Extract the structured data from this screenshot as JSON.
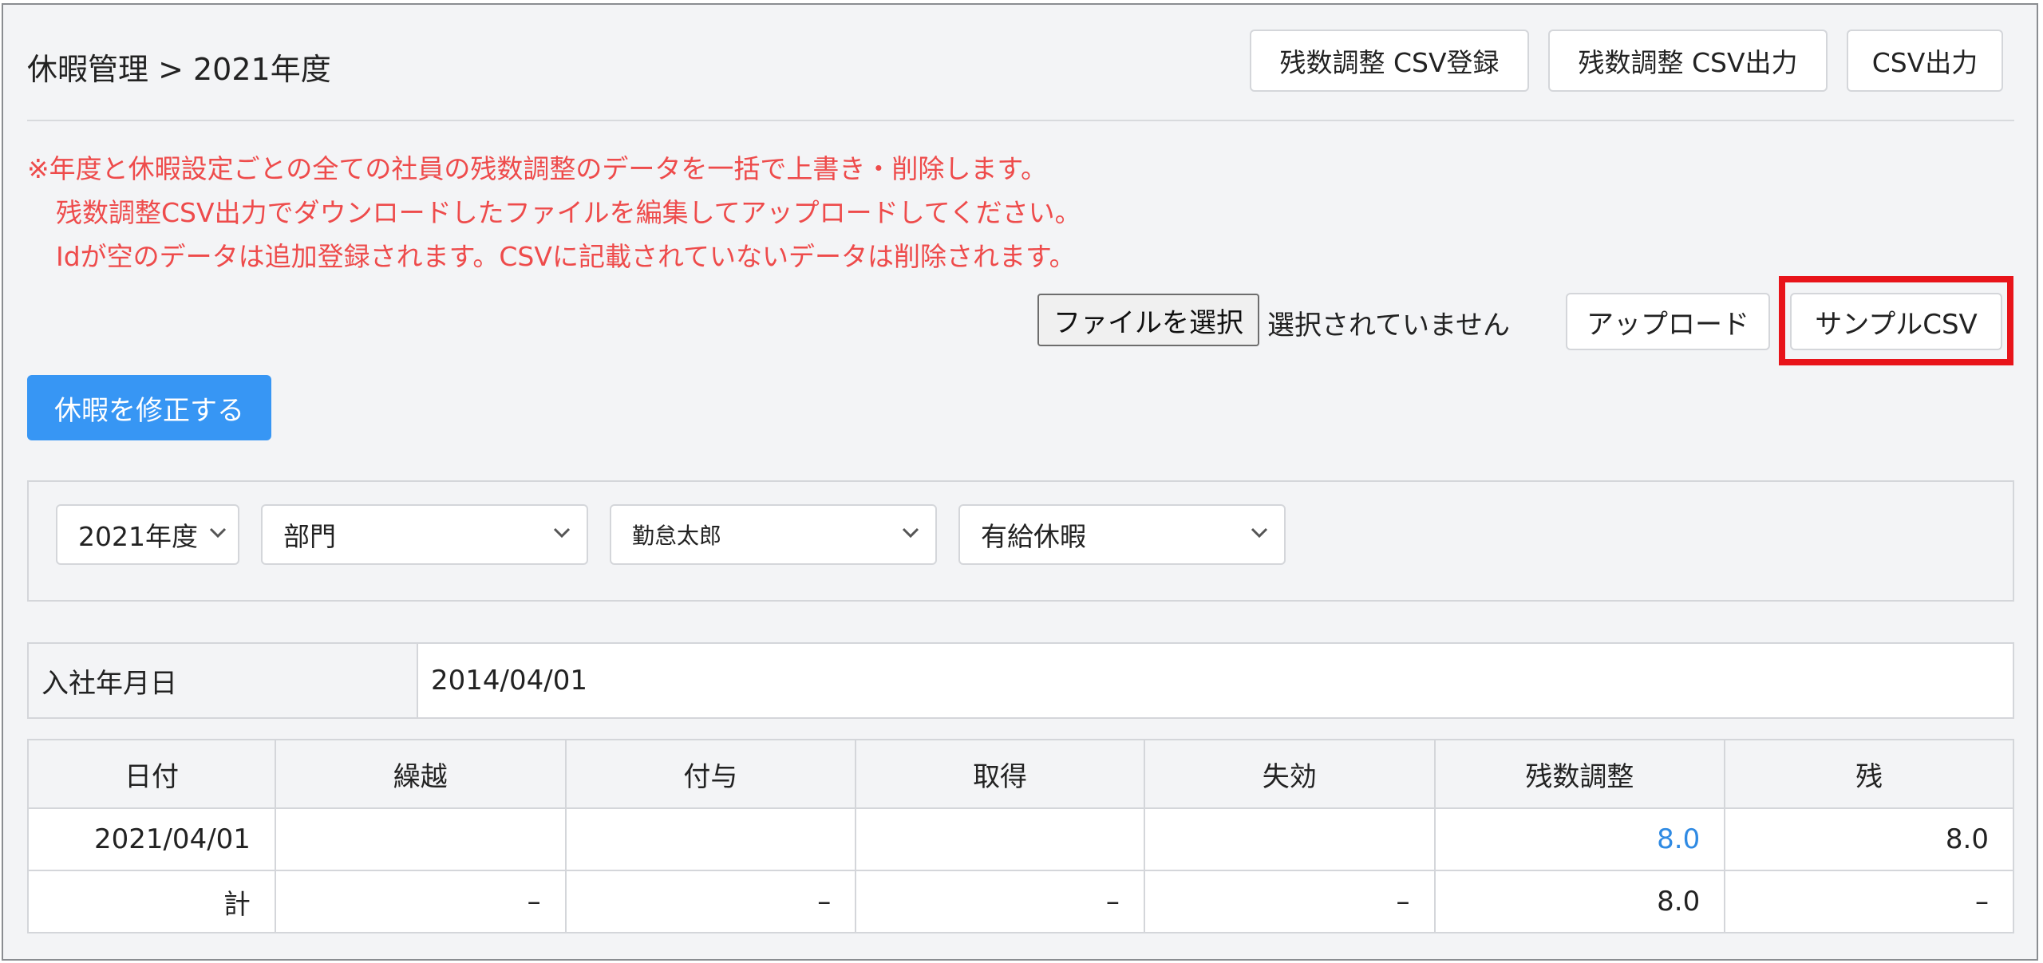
{
  "header": {
    "title": "休暇管理 > 2021年度",
    "btn_csv_register": "残数調整 CSV登録",
    "btn_csv_export_adjust": "残数調整 CSV出力",
    "btn_csv_export": "CSV出力"
  },
  "notes": [
    "※年度と休暇設定ごとの全ての社員の残数調整のデータを一括で上書き・削除します。",
    "残数調整CSV出力でダウンロードしたファイルを編集してアップロードしてください。",
    "Idが空のデータは追加登録されます。CSVに記載されていないデータは削除されます。"
  ],
  "upload": {
    "file_button": "ファイルを選択",
    "file_status": "選択されていません",
    "upload_button": "アップロード",
    "sample_button": "サンプルCSV"
  },
  "actions": {
    "edit_button": "休暇を修正する"
  },
  "filters": {
    "year": "2021年度",
    "department": "部門",
    "employee": "勤怠太郎",
    "leave_type": "有給休暇"
  },
  "info": {
    "label": "入社年月日",
    "value": "2014/04/01"
  },
  "table": {
    "headers": [
      "日付",
      "繰越",
      "付与",
      "取得",
      "失効",
      "残数調整",
      "残"
    ],
    "rows": [
      [
        "2021/04/01",
        "",
        "",
        "",
        "",
        "8.0",
        "8.0"
      ],
      [
        "計",
        "–",
        "–",
        "–",
        "–",
        "8.0",
        "–"
      ]
    ]
  },
  "colors": {
    "note_text": "#ee4b4b",
    "primary": "#3796f4",
    "highlight": "#e8141a",
    "link": "#2f8ae3"
  }
}
